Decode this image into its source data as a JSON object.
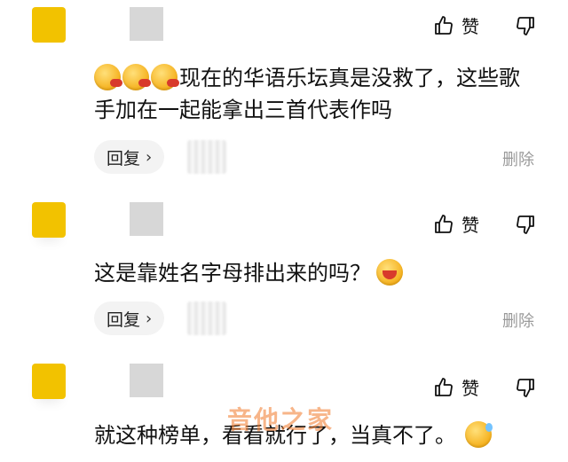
{
  "comments": [
    {
      "text": "现在的华语乐坛真是没救了，这些歌手加在一起能拿出三首代表作吗",
      "like_label": "赞",
      "reply_label": "回复",
      "reply_chevron": "›",
      "delete_label": "删除",
      "emojis": [
        "vomit-emoji",
        "vomit-emoji",
        "vomit-emoji"
      ]
    },
    {
      "text": "这是靠姓名字母排出来的吗？",
      "like_label": "赞",
      "reply_label": "回复",
      "reply_chevron": "›",
      "delete_label": "删除",
      "emojis": [
        "laugh-emoji"
      ]
    },
    {
      "text": "就这种榜单，看看就行了，当真不了。",
      "like_label": "赞",
      "emojis": [
        "sweat-emoji"
      ]
    }
  ],
  "watermark": "音他之家",
  "colors": {
    "avatar": "#f2c200",
    "name_placeholder": "#d7d7d7",
    "reply_bg": "#f3f3f3",
    "muted": "#9a9a9a"
  }
}
